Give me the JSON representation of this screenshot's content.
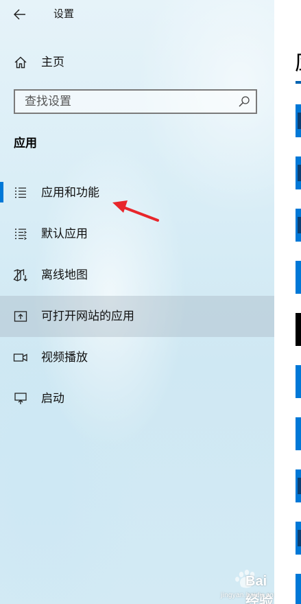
{
  "window": {
    "title": "设置"
  },
  "nav": {
    "back_icon": "arrow-left-icon",
    "home": {
      "label": "主页",
      "icon": "home-icon"
    }
  },
  "search": {
    "placeholder": "查找设置",
    "value": "",
    "icon": "search-icon"
  },
  "section": {
    "title": "应用"
  },
  "items": [
    {
      "label": "应用和功能",
      "icon": "list-icon",
      "active": true
    },
    {
      "label": "默认应用",
      "icon": "list-default-icon",
      "active": false
    },
    {
      "label": "离线地图",
      "icon": "map-download-icon",
      "active": false
    },
    {
      "label": "可打开网站的应用",
      "icon": "open-in-app-icon",
      "active": false,
      "hover": true
    },
    {
      "label": "视频播放",
      "icon": "video-icon",
      "active": false
    },
    {
      "label": "启动",
      "icon": "startup-icon",
      "active": false
    }
  ],
  "content": {
    "title_partial": "应"
  },
  "watermark": {
    "text": "Bai 经验",
    "url_text": "jingyan.baidu.com"
  },
  "colors": {
    "accent": "#0078d7",
    "annotation_arrow": "#e8262b"
  }
}
